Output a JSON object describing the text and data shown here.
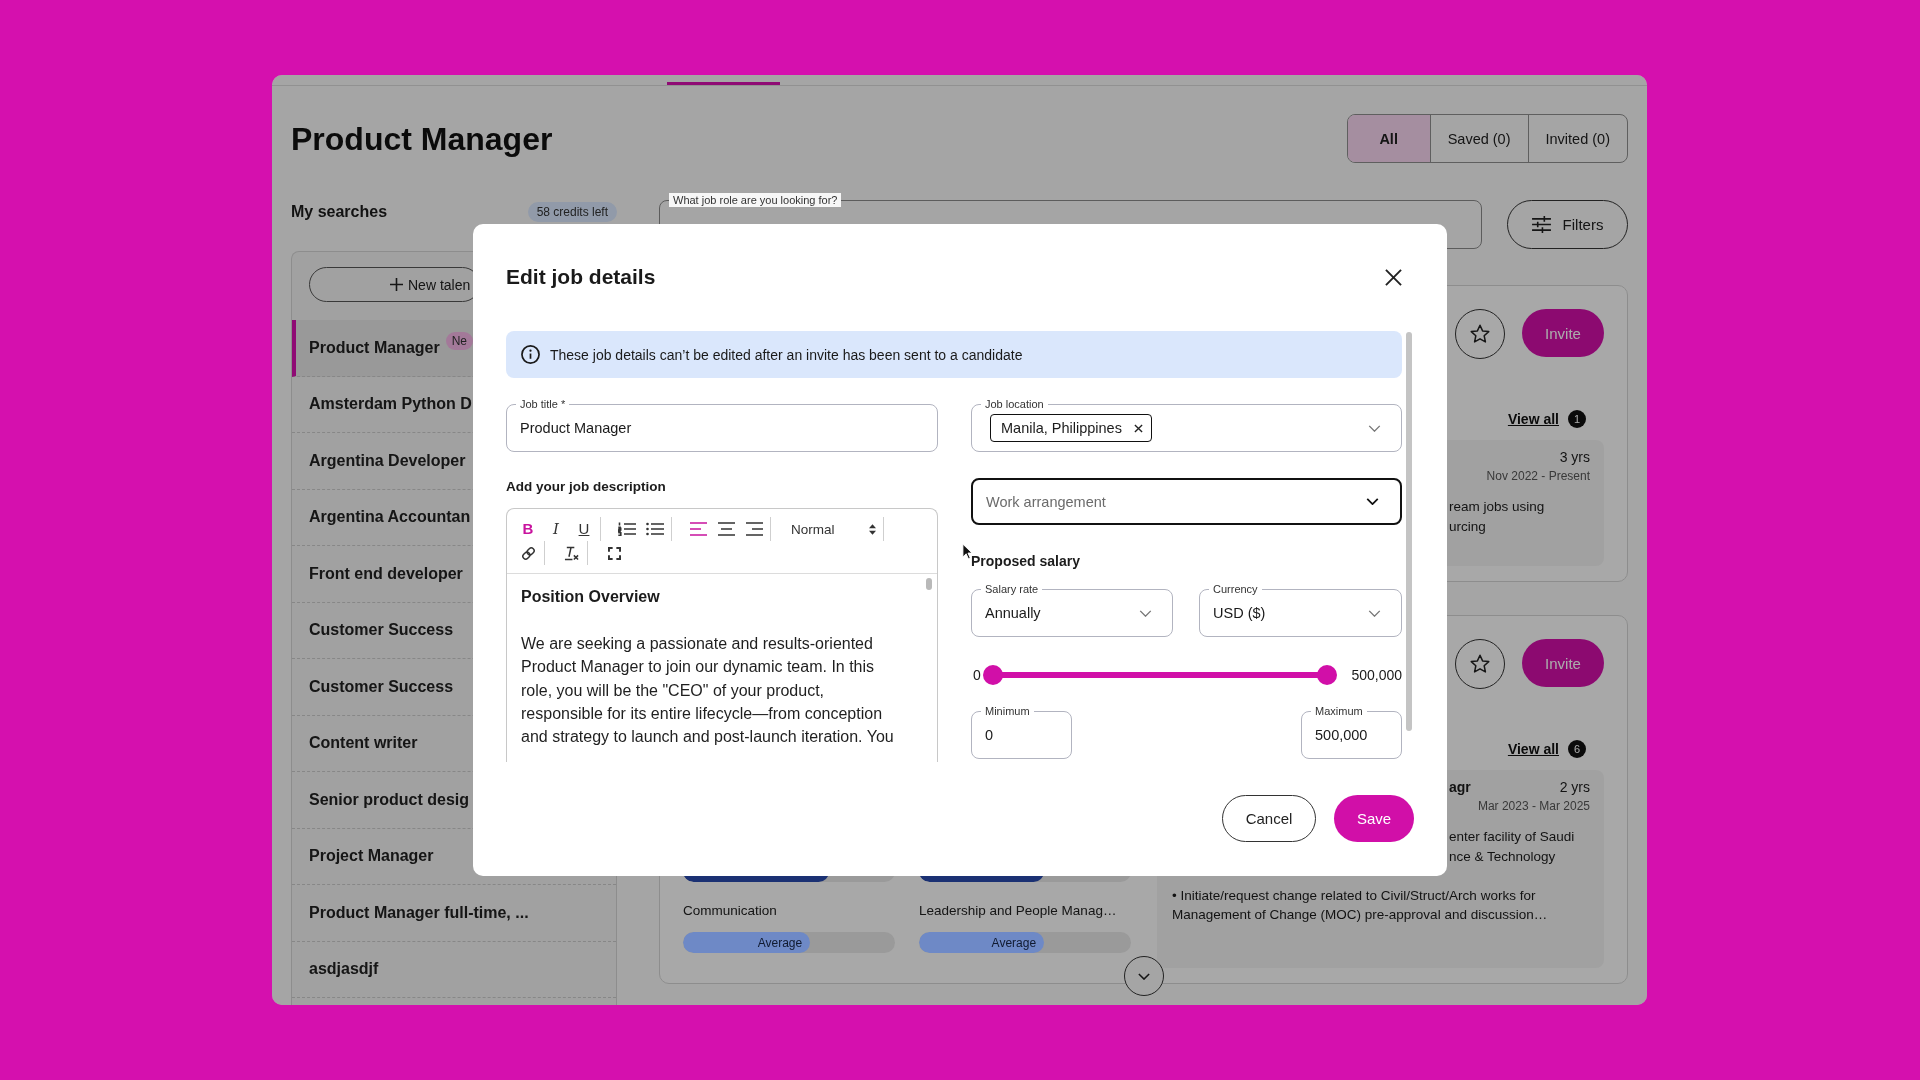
{
  "page": {
    "title": "Product Manager"
  },
  "view_tabs": [
    {
      "label": "All",
      "selected": true
    },
    {
      "label": "Saved (0)",
      "selected": false
    },
    {
      "label": "Invited (0)",
      "selected": false
    }
  ],
  "searches": {
    "title": "My searches",
    "credits": "58 credits left",
    "new_search_button": "New talen",
    "items": [
      {
        "label": "Product Manager",
        "selected": true,
        "badge": "Ne"
      },
      {
        "label": "Amsterdam Python D",
        "selected": false
      },
      {
        "label": "Argentina Developer",
        "selected": false
      },
      {
        "label": "Argentina Accountan",
        "selected": false
      },
      {
        "label": "Front end developer",
        "selected": false
      },
      {
        "label": "Customer Success",
        "selected": false
      },
      {
        "label": "Customer Success",
        "selected": false
      },
      {
        "label": "Content writer",
        "selected": false
      },
      {
        "label": "Senior product desig",
        "selected": false
      },
      {
        "label": "Project Manager",
        "selected": false
      },
      {
        "label": "Product Manager full-time, ...",
        "selected": false
      },
      {
        "label": "asdjasdjf",
        "selected": false
      }
    ]
  },
  "search": {
    "label": "What job role are you looking for?"
  },
  "filters_button": "Filters",
  "candidates": [
    {
      "starred": false,
      "invite": "Invite",
      "view_all": "View all",
      "view_count": "1",
      "experience": {
        "duration": "3 yrs",
        "dates": "Nov 2022 - Present",
        "fragments": [
          "ream jobs using",
          "urcing"
        ]
      }
    },
    {
      "starred": false,
      "invite": "Invite",
      "view_all": "View all",
      "view_count": "6",
      "skills": [
        {
          "level": 0.69,
          "color": "#1b3173"
        },
        {
          "level": 0.59,
          "color": "#1b3173"
        },
        {
          "name": "Communication",
          "rating": "Average",
          "level": 0.6,
          "color": "#6e89c6"
        },
        {
          "name": "Leadership and People Manag…",
          "rating": "Average",
          "level": 0.59,
          "color": "#6e89c6"
        }
      ],
      "experience": {
        "title_fragment": "agr",
        "duration": "2 yrs",
        "dates": "Mar 2023 - Mar 2025",
        "fragments": [
          "enter facility of Saudi",
          "nce & Technology"
        ],
        "bullet": "• Initiate/request change related to Civil/Struct/Arch works for Management of Change (MOC) pre-approval and discussion…"
      }
    }
  ],
  "modal": {
    "title": "Edit job details",
    "notice": "These job details can’t be edited after an invite has been sent to a candidate",
    "job_title": {
      "label": "Job title *",
      "value": "Product Manager"
    },
    "description": {
      "label": "Add your job description",
      "toolbar": [
        {
          "buttons": [
            {
              "kind": "bold",
              "glyph": "B",
              "active": true
            },
            {
              "kind": "italic",
              "glyph": "I",
              "active": false
            },
            {
              "kind": "underline",
              "glyph": "U",
              "active": false
            }
          ]
        },
        {
          "buttons": [
            {
              "kind": "ordered-list",
              "active": false
            },
            {
              "kind": "bullet-list",
              "active": false
            }
          ]
        },
        {
          "buttons": [
            {
              "kind": "align-left",
              "active": true
            },
            {
              "kind": "align-center",
              "active": false
            },
            {
              "kind": "align-right",
              "active": false
            }
          ]
        },
        {
          "buttons": [
            {
              "kind": "picker",
              "value": "Normal"
            }
          ]
        },
        {
          "buttons": [
            {
              "kind": "link",
              "active": false
            }
          ]
        },
        {
          "buttons": [
            {
              "kind": "clean",
              "active": false
            }
          ]
        },
        {
          "buttons": [
            {
              "kind": "fullscreen",
              "active": false
            }
          ]
        }
      ],
      "heading": "Position Overview",
      "paragraph": "We are seeking a passionate and results-oriented Product Manager to join our dynamic team. In this role, you will be the \"CEO\" of your product, responsible for its entire lifecycle—from conception and strategy to launch and post-launch iteration. You"
    },
    "job_location": {
      "label": "Job location",
      "chips": [
        {
          "label": "Manila, Philippines"
        }
      ]
    },
    "work_arrangement": {
      "placeholder": "Work arrangement",
      "focused": true
    },
    "salary": {
      "title": "Proposed salary",
      "rate": {
        "label": "Salary rate",
        "value": "Annually"
      },
      "currency": {
        "label": "Currency",
        "value": "USD ($)"
      },
      "range_min": "0",
      "range_max": "500,000",
      "low_thumb": {
        "level": 0
      },
      "high_thumb": {
        "level": 1
      },
      "minimum": {
        "label": "Minimum",
        "value": "0"
      },
      "maximum": {
        "label": "Maximum",
        "value": "500,000"
      }
    },
    "buttons": [
      {
        "label": "Cancel",
        "kind": "secondary"
      },
      {
        "label": "Save",
        "kind": "primary"
      }
    ]
  }
}
